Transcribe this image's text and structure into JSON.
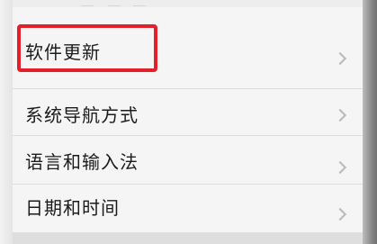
{
  "settings_menu": {
    "items": [
      {
        "label": "软件更新",
        "highlighted": true
      },
      {
        "label": "系统导航方式",
        "highlighted": false
      },
      {
        "label": "语言和输入法",
        "highlighted": false
      },
      {
        "label": "日期和时间",
        "highlighted": false
      }
    ],
    "chevron_icon": "chevron-right-icon"
  },
  "colors": {
    "highlight": "#e3202a",
    "item_background": "#f5f5f5",
    "text": "#1c1c1c",
    "chevron": "#b9b9b9"
  }
}
